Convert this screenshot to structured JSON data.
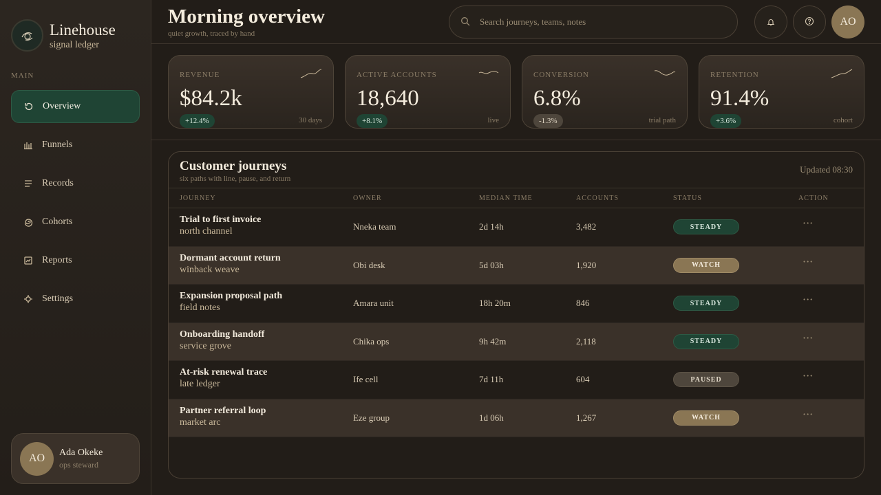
{
  "brand": {
    "name": "Linehouse",
    "tagline": "signal ledger"
  },
  "nav": {
    "section_label": "MAIN",
    "items": [
      {
        "label": "Overview",
        "icon": "loop-icon",
        "active": true
      },
      {
        "label": "Funnels",
        "icon": "bar-chart-icon",
        "active": false
      },
      {
        "label": "Records",
        "icon": "list-icon",
        "active": false
      },
      {
        "label": "Cohorts",
        "icon": "spiral-icon",
        "active": false
      },
      {
        "label": "Reports",
        "icon": "report-icon",
        "active": false
      },
      {
        "label": "Settings",
        "icon": "gear-icon",
        "active": false
      }
    ]
  },
  "user": {
    "initials": "AO",
    "name": "Ada Okeke",
    "role": "ops steward"
  },
  "header": {
    "title": "Morning overview",
    "subtitle": "quiet growth, traced by hand",
    "search_placeholder": "Search journeys, teams, notes",
    "avatar_initials": "AO"
  },
  "kpis": [
    {
      "label": "REVENUE",
      "value": "$84.2k",
      "delta": "+12.4%",
      "trend": "pos",
      "note": "30 days"
    },
    {
      "label": "ACTIVE ACCOUNTS",
      "value": "18,640",
      "delta": "+8.1%",
      "trend": "pos",
      "note": "live"
    },
    {
      "label": "CONVERSION",
      "value": "6.8%",
      "delta": "-1.3%",
      "trend": "neg",
      "note": "trial path"
    },
    {
      "label": "RETENTION",
      "value": "91.4%",
      "delta": "+3.6%",
      "trend": "pos",
      "note": "cohort"
    }
  ],
  "table": {
    "title": "Customer journeys",
    "subtitle": "six paths with line, pause, and return",
    "updated": "Updated 08:30",
    "columns": [
      "JOURNEY",
      "OWNER",
      "MEDIAN TIME",
      "ACCOUNTS",
      "STATUS",
      "ACTION"
    ],
    "rows": [
      {
        "title": "Trial to first invoice",
        "sub": "north channel",
        "owner": "Nneka team",
        "time": "2d 14h",
        "accounts": "3,482",
        "status": "STEADY",
        "status_kind": "steady"
      },
      {
        "title": "Dormant account return",
        "sub": "winback weave",
        "owner": "Obi desk",
        "time": "5d 03h",
        "accounts": "1,920",
        "status": "WATCH",
        "status_kind": "watch"
      },
      {
        "title": "Expansion proposal path",
        "sub": "field notes",
        "owner": "Amara unit",
        "time": "18h 20m",
        "accounts": "846",
        "status": "STEADY",
        "status_kind": "steady"
      },
      {
        "title": "Onboarding handoff",
        "sub": "service grove",
        "owner": "Chika ops",
        "time": "9h 42m",
        "accounts": "2,118",
        "status": "STEADY",
        "status_kind": "steady"
      },
      {
        "title": "At-risk renewal trace",
        "sub": "late ledger",
        "owner": "Ife cell",
        "time": "7d 11h",
        "accounts": "604",
        "status": "PAUSED",
        "status_kind": "paused"
      },
      {
        "title": "Partner referral loop",
        "sub": "market arc",
        "owner": "Eze group",
        "time": "1d 06h",
        "accounts": "1,267",
        "status": "WATCH",
        "status_kind": "watch"
      }
    ],
    "action_glyph": "···"
  },
  "colors": {
    "accent_green": "#1f4434",
    "accent_gold": "#8a7654",
    "background": "#221d18",
    "neutral_pill": "#4e463c"
  }
}
